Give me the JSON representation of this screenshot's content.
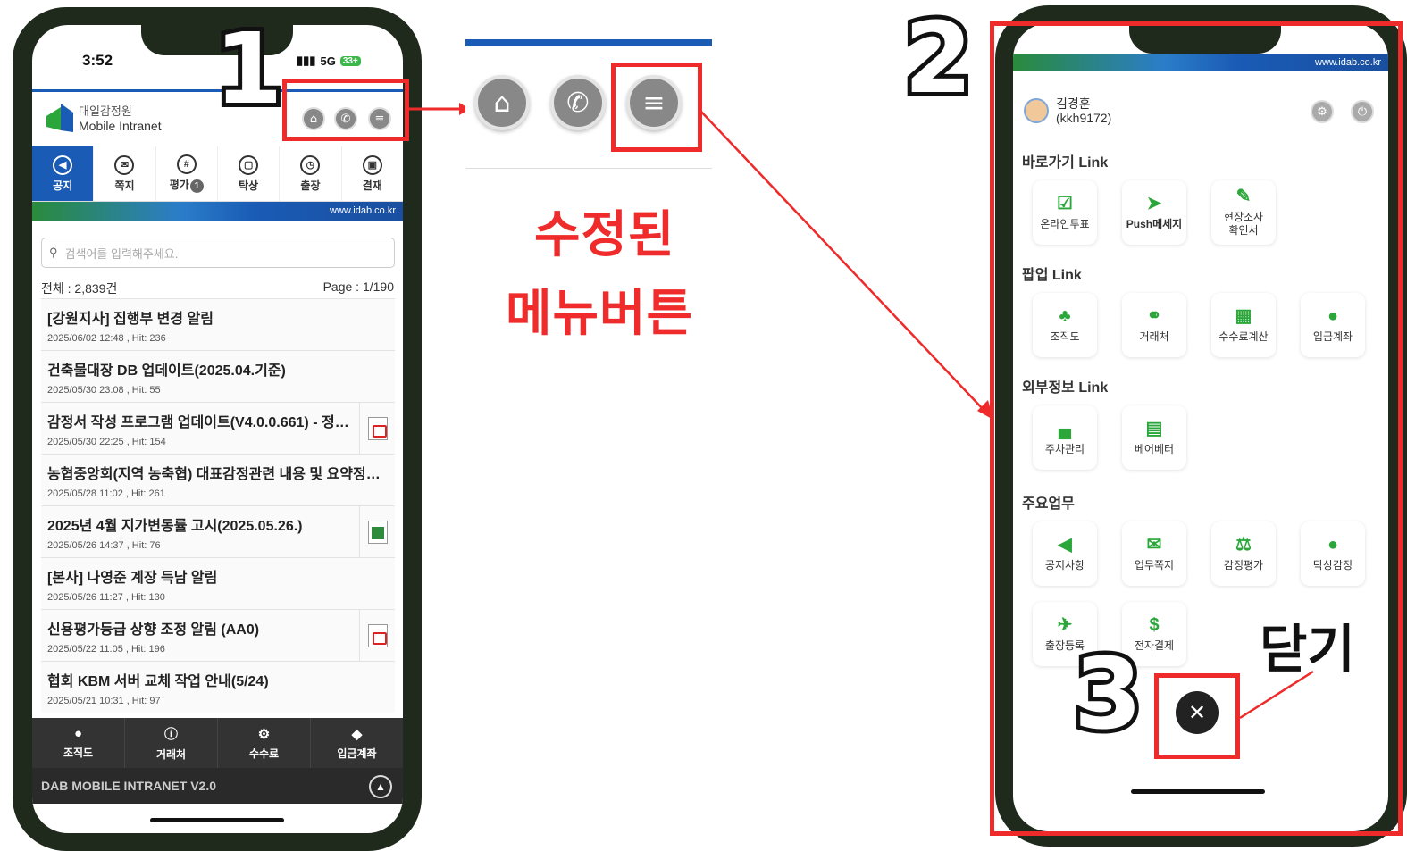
{
  "phone1": {
    "status": {
      "time": "3:52",
      "signal": "5G",
      "battery": "33+"
    },
    "logo": {
      "line1": "대일감정원",
      "line2": "Mobile Intranet"
    },
    "header_icons": [
      "home-icon",
      "phone-icon",
      "menu-icon"
    ],
    "tabs": [
      {
        "label": "공지",
        "icon": "speaker-icon",
        "active": true
      },
      {
        "label": "쪽지",
        "icon": "mail-icon"
      },
      {
        "label": "평가",
        "icon": "grid-icon",
        "badge": "1"
      },
      {
        "label": "탁상",
        "icon": "chat-icon"
      },
      {
        "label": "출장",
        "icon": "clock-icon"
      },
      {
        "label": "결재",
        "icon": "lock-icon"
      }
    ],
    "banner_url": "www.idab.co.kr",
    "search_placeholder": "검색어를 입력해주세요.",
    "total": "전체 : 2,839건",
    "page": "Page : 1/190",
    "posts": [
      {
        "title": "[강원지사] 집행부 변경 알림",
        "meta": "2025/06/02 12:48 ,  Hit: 236",
        "attach": ""
      },
      {
        "title": "건축물대장 DB 업데이트(2025.04.기준)",
        "meta": "2025/05/30 23:08 ,  Hit: 55",
        "attach": ""
      },
      {
        "title": "감정서 작성 프로그램 업데이트(V4.0.0.661) - 정…",
        "meta": "2025/05/30 22:25 ,  Hit: 154",
        "attach": "pdf"
      },
      {
        "title": "농협중앙회(지역 농축협) 대표감정관련 내용 및 요약정리 안내",
        "meta": "2025/05/28 11:02 ,  Hit: 261",
        "attach": ""
      },
      {
        "title": "2025년 4월 지가변동률 고시(2025.05.26.)",
        "meta": "2025/05/26 14:37 ,  Hit: 76",
        "attach": "xls"
      },
      {
        "title": "[본사] 나영준 계장 득남 알림",
        "meta": "2025/05/26 11:27 ,  Hit: 130",
        "attach": ""
      },
      {
        "title": "신용평가등급 상향 조정 알림 (AA0)",
        "meta": "2025/05/22 11:05 ,  Hit: 196",
        "attach": "pdf"
      },
      {
        "title": "협회 KBM 서버 교체 작업 안내(5/24)",
        "meta": "2025/05/21 10:31 ,  Hit: 97",
        "attach": ""
      }
    ],
    "bottom_nav": [
      {
        "label": "조직도",
        "icon": "person-icon"
      },
      {
        "label": "거래처",
        "icon": "info-icon"
      },
      {
        "label": "수수료",
        "icon": "gear-icon"
      },
      {
        "label": "입금계좌",
        "icon": "tag-icon"
      }
    ],
    "footer": "DAB MOBILE INTRANET V2.0"
  },
  "annotations": {
    "step1": "1",
    "step2": "2",
    "step3": "3",
    "caption_line1": "수정된",
    "caption_line2": "메뉴버튼",
    "close_label": "닫기",
    "accent_color": "#ee2a2a"
  },
  "phone2": {
    "banner_url": "www.idab.co.kr",
    "user": {
      "name": "김경훈",
      "id": "(kkh9172)"
    },
    "sections": [
      {
        "title": "바로가기 Link",
        "items": [
          {
            "label": "온라인투표",
            "icon": "check-icon"
          },
          {
            "label": "Push메세지",
            "icon": "send-icon"
          },
          {
            "label": "현장조사\n확인서",
            "icon": "sign-icon"
          }
        ]
      },
      {
        "title": "팝업 Link",
        "items": [
          {
            "label": "조직도",
            "icon": "org-icon"
          },
          {
            "label": "거래처",
            "icon": "handshake-icon"
          },
          {
            "label": "수수료계산",
            "icon": "calculator-icon"
          },
          {
            "label": "입금계좌",
            "icon": "piggybank-icon"
          }
        ]
      },
      {
        "title": "외부정보 Link",
        "items": [
          {
            "label": "주차관리",
            "icon": "car-icon"
          },
          {
            "label": "베어베터",
            "icon": "store-icon"
          }
        ]
      },
      {
        "title": "주요업무",
        "items": [
          {
            "label": "공지사항",
            "icon": "megaphone-icon"
          },
          {
            "label": "업무쪽지",
            "icon": "envelope-icon"
          },
          {
            "label": "감정평가",
            "icon": "scale-icon"
          },
          {
            "label": "탁상감정",
            "icon": "chat-icon"
          },
          {
            "label": "출장등록",
            "icon": "plane-icon"
          },
          {
            "label": "전자결제",
            "icon": "doc-icon"
          }
        ]
      }
    ]
  }
}
